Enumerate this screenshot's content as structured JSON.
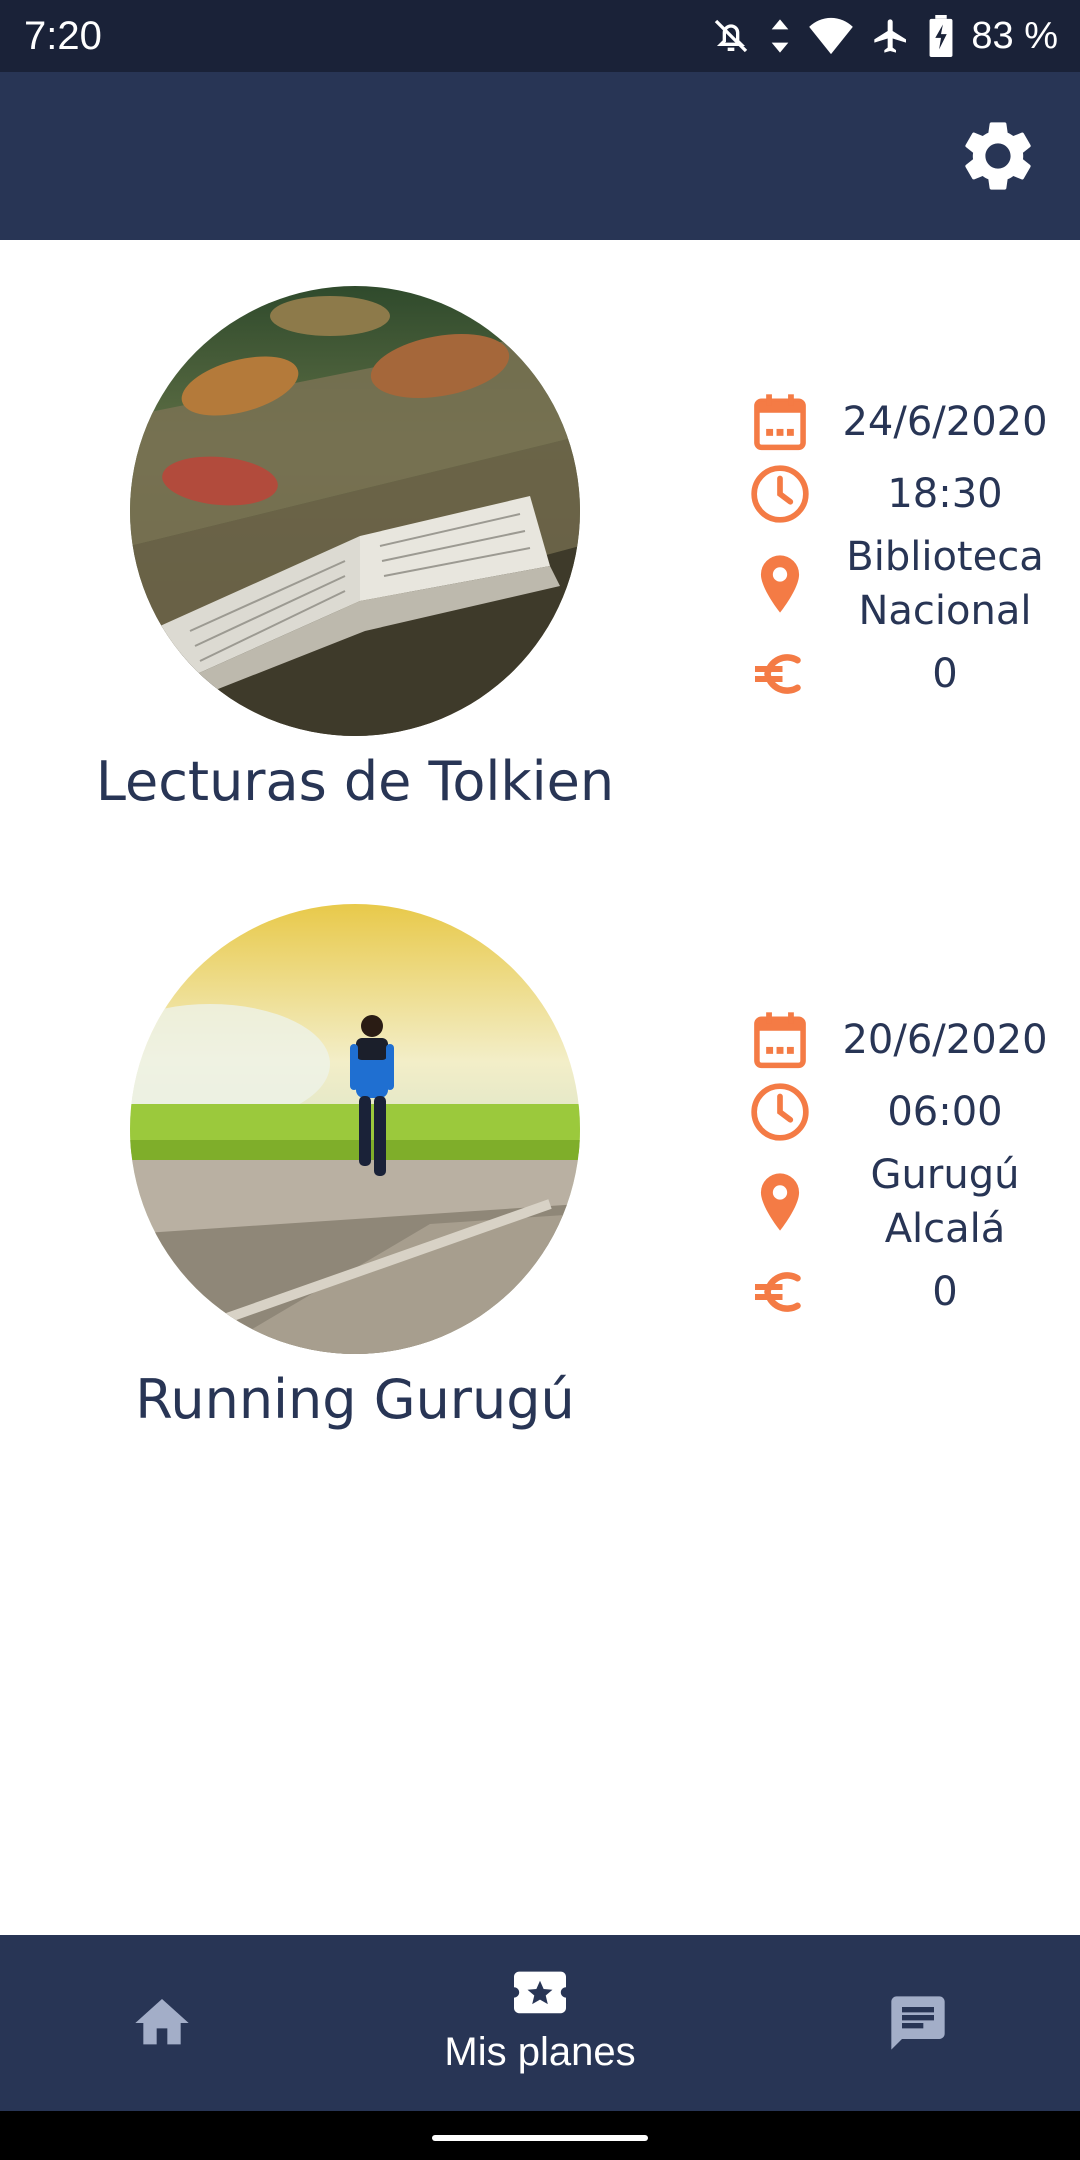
{
  "status_bar": {
    "time": "7:20",
    "battery": "83 %",
    "icons": [
      "notifications-off-icon",
      "data-arrows-icon",
      "wifi-icon",
      "airplane-icon",
      "battery-charging-icon"
    ]
  },
  "app_bar": {
    "settings_icon": "gear-icon"
  },
  "plans": [
    {
      "title": "Lecturas de Tolkien",
      "image": "open-book-on-table-photo",
      "date": "24/6/2020",
      "time": "18:30",
      "place": "Biblioteca\nNacional",
      "price": "0"
    },
    {
      "title": "Running Gurugú",
      "image": "runner-on-road-photo",
      "date": "20/6/2020",
      "time": "06:00",
      "place": "Gurugú\nAlcalá",
      "price": "0"
    }
  ],
  "bottom_nav": {
    "items": [
      {
        "icon": "home-icon",
        "label": ""
      },
      {
        "icon": "ticket-star-icon",
        "label": "Mis planes"
      },
      {
        "icon": "chat-icon",
        "label": ""
      }
    ]
  },
  "colors": {
    "primary": "#283555",
    "status_bar": "#1a2238",
    "accent": "#f47b45",
    "text": "#283555"
  }
}
